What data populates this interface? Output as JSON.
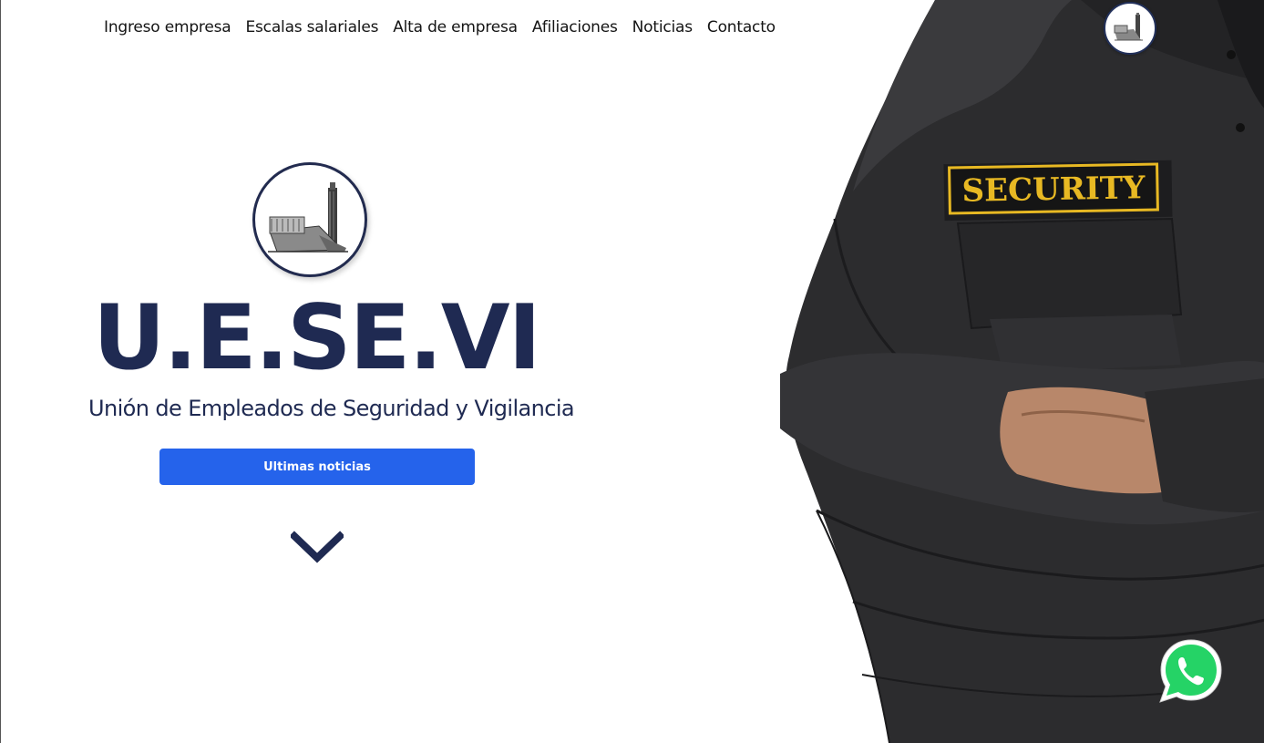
{
  "nav": {
    "items": [
      {
        "label": "Ingreso empresa"
      },
      {
        "label": "Escalas salariales"
      },
      {
        "label": "Alta de empresa"
      },
      {
        "label": "Afiliaciones"
      },
      {
        "label": "Noticias"
      },
      {
        "label": "Contacto"
      }
    ]
  },
  "hero": {
    "brand": "U.E.SE.VI",
    "subtitle": "Unión de Empleados de Seguridad y Vigilancia",
    "cta_label": "Ultimas noticias",
    "icons": {
      "logo": "building-tower-logo",
      "scroll": "chevron-down-icon",
      "whatsapp": "whatsapp-icon"
    }
  },
  "guard_image": {
    "patch_text": "SECURITY"
  },
  "colors": {
    "brand_navy": "#1f2a52",
    "cta_blue": "#2563eb",
    "whatsapp_green": "#25d366",
    "uniform": "#2c2c2e",
    "patch_gold": "#e8b923"
  }
}
